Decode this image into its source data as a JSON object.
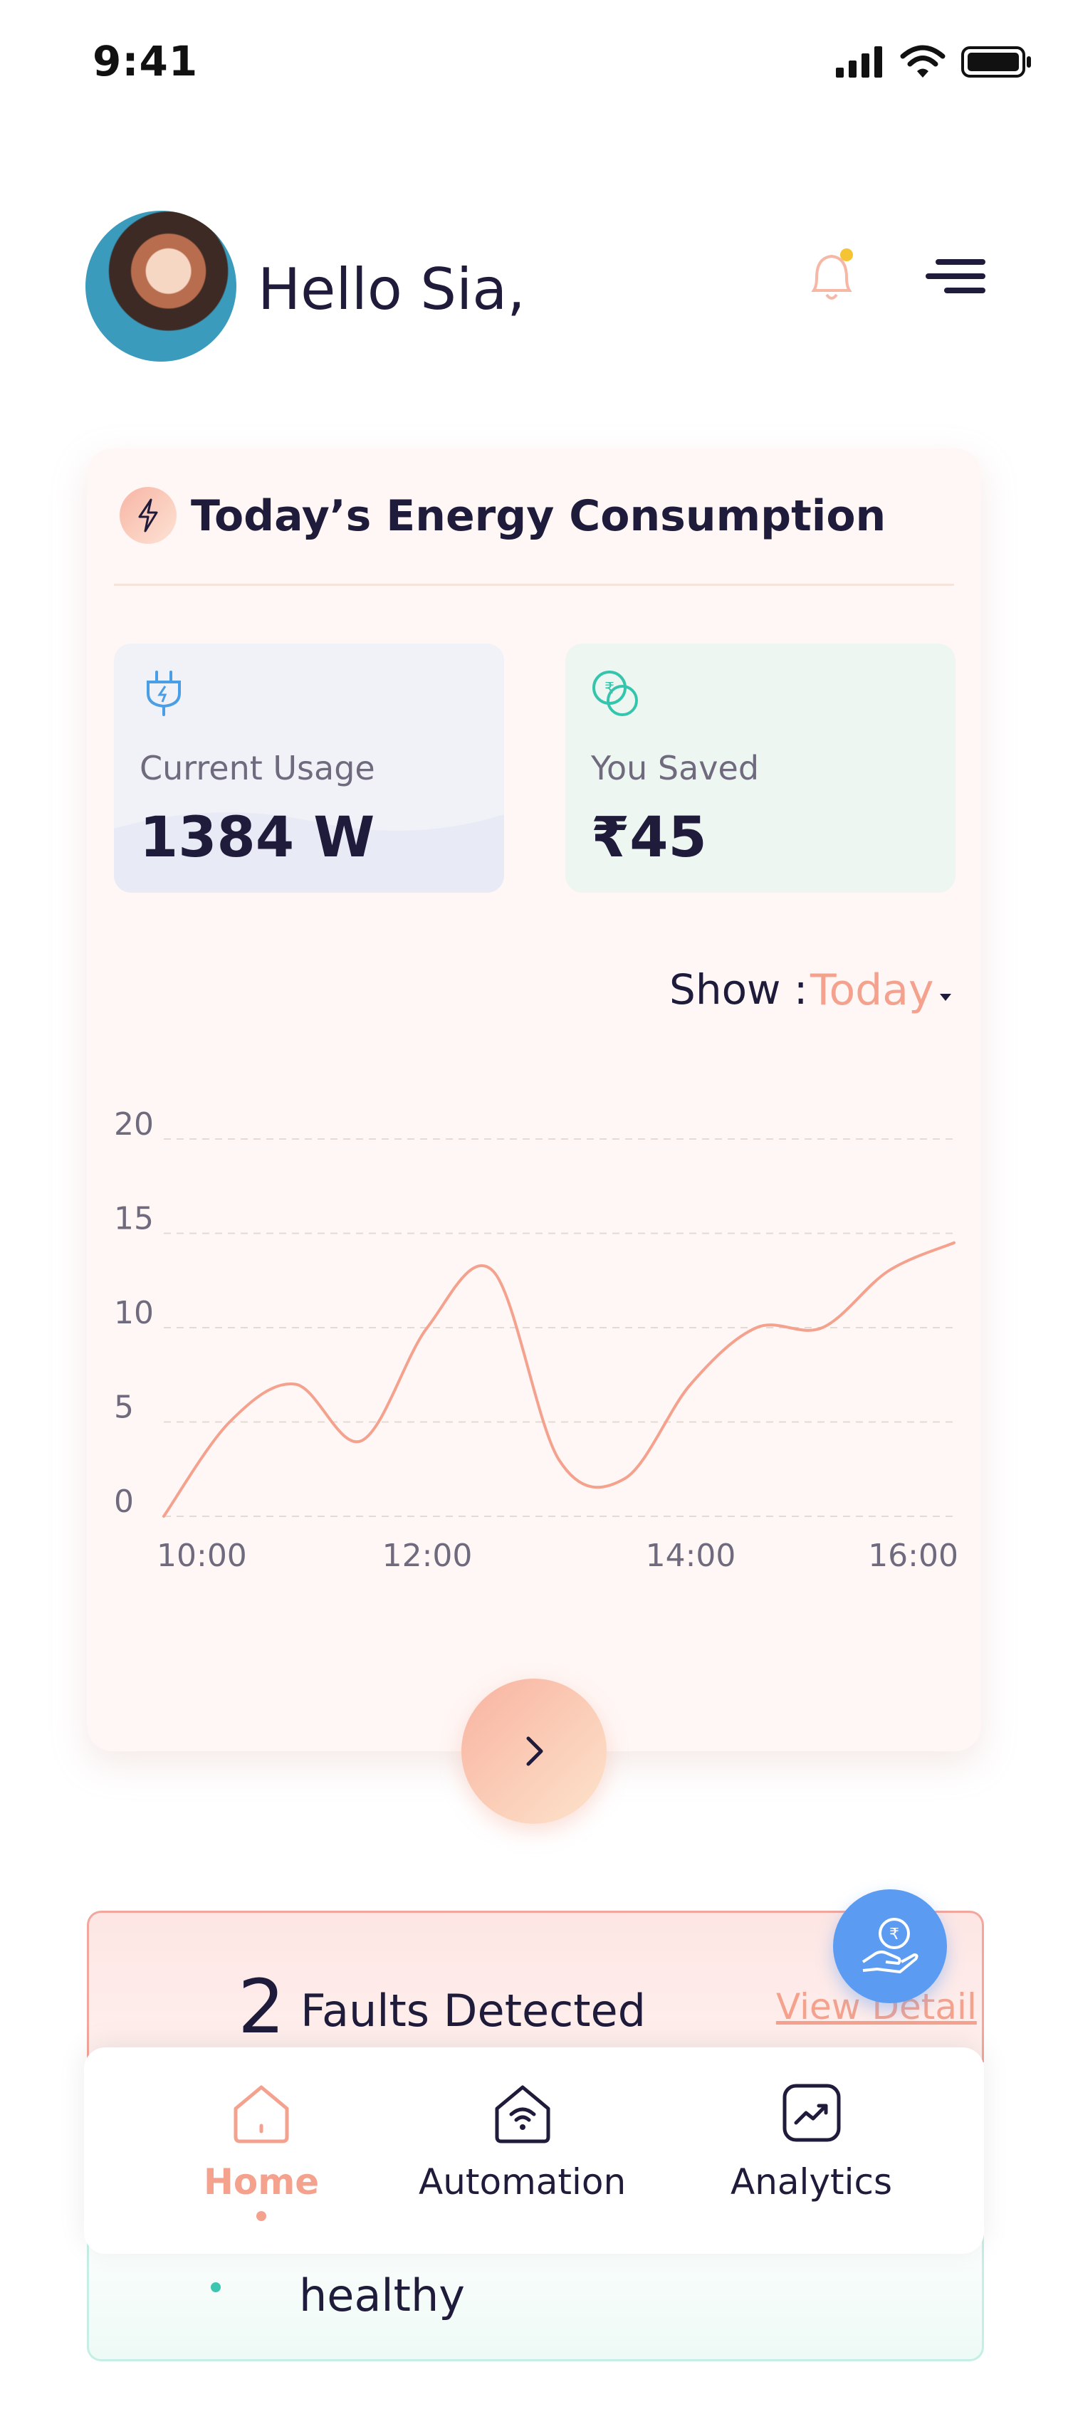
{
  "status_bar": {
    "time": "9:41"
  },
  "header": {
    "greeting": "Hello Sia,"
  },
  "energy_card": {
    "title": "Today’s Energy Consumption",
    "current_usage": {
      "label": "Current Usage",
      "value": "1384 W"
    },
    "you_saved": {
      "label": "You Saved",
      "value": "₹45"
    },
    "show": {
      "label": "Show :",
      "value": "Today"
    }
  },
  "chart_data": {
    "type": "line",
    "x": [
      "10:00",
      "10:30",
      "11:00",
      "11:30",
      "12:00",
      "12:30",
      "13:00",
      "13:30",
      "14:00",
      "14:30",
      "15:00",
      "15:30",
      "16:00"
    ],
    "y": [
      0,
      5,
      7,
      4,
      10,
      13,
      3,
      2,
      7,
      10,
      10,
      13,
      14.5
    ],
    "x_tick_labels": [
      "10:00",
      "12:00",
      "14:00",
      "16:00"
    ],
    "y_tick_labels": [
      "0",
      "5",
      "10",
      "15",
      "20"
    ],
    "ylim": [
      0,
      20
    ],
    "grid": true,
    "colors": {
      "line": "#f4a28e",
      "grid": "#e6d8d2"
    }
  },
  "faults": {
    "count": "2",
    "label": "Faults Detected",
    "view_detail": "View Detail"
  },
  "health": {
    "text": "healthy"
  },
  "bottom_nav": {
    "items": [
      {
        "label": "Home",
        "icon": "home-icon",
        "active": true
      },
      {
        "label": "Automation",
        "icon": "automation-icon"
      },
      {
        "label": "Analytics",
        "icon": "analytics-icon"
      }
    ]
  },
  "colors": {
    "accent": "#f4a28e",
    "fab": "#5b9cf2",
    "dark": "#1f1b3a"
  }
}
